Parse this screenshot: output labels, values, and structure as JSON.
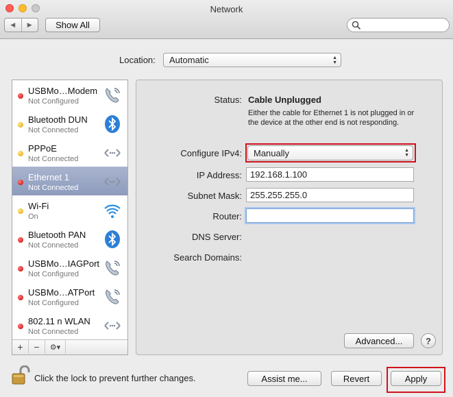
{
  "window": {
    "title": "Network"
  },
  "toolbar": {
    "show_all_label": "Show All",
    "back_icon": "back-arrow-icon",
    "forward_icon": "forward-arrow-icon",
    "search_placeholder": ""
  },
  "location": {
    "label": "Location:",
    "value": "Automatic"
  },
  "services": [
    {
      "name": "USBMo…Modem",
      "status": "Not Configured",
      "dot": "red",
      "icon": "phone-icon"
    },
    {
      "name": "Bluetooth DUN",
      "status": "Not Connected",
      "dot": "yellow",
      "icon": "bluetooth-icon"
    },
    {
      "name": "PPPoE",
      "status": "Not Connected",
      "dot": "yellow",
      "icon": "ethernet-arrows-icon"
    },
    {
      "name": "Ethernet 1",
      "status": "Not Connected",
      "dot": "red",
      "icon": "ethernet-arrows-icon",
      "selected": true
    },
    {
      "name": "Wi-Fi",
      "status": "On",
      "dot": "yellow",
      "icon": "wifi-icon"
    },
    {
      "name": "Bluetooth PAN",
      "status": "Not Connected",
      "dot": "red",
      "icon": "bluetooth-icon"
    },
    {
      "name": "USBMo…IAGPort",
      "status": "Not Configured",
      "dot": "red",
      "icon": "phone-icon"
    },
    {
      "name": "USBMo…ATPort",
      "status": "Not Configured",
      "dot": "red",
      "icon": "phone-icon"
    },
    {
      "name": "802.11 n WLAN",
      "status": "Not Connected",
      "dot": "red",
      "icon": "ethernet-arrows-icon"
    }
  ],
  "sidebar_toolbar": {
    "add": "+",
    "remove": "−",
    "gear": "⚙▾"
  },
  "details": {
    "status_label": "Status:",
    "status_value": "Cable Unplugged",
    "status_description": "Either the cable for Ethernet 1 is not plugged in or the device at the other end is not responding.",
    "configure_label": "Configure IPv4:",
    "configure_value": "Manually",
    "ip_label": "IP Address:",
    "ip_value": "192.168.1.100",
    "subnet_label": "Subnet Mask:",
    "subnet_value": "255.255.255.0",
    "router_label": "Router:",
    "router_value": "",
    "dns_label": "DNS Server:",
    "search_domains_label": "Search Domains:",
    "advanced_label": "Advanced...",
    "help_label": "?"
  },
  "footer": {
    "lock_text": "Click the lock to prevent further changes.",
    "assist_label": "Assist me...",
    "revert_label": "Revert",
    "apply_label": "Apply"
  },
  "colors": {
    "highlight_red": "#d0111b",
    "selection": "#8d9bbd"
  }
}
